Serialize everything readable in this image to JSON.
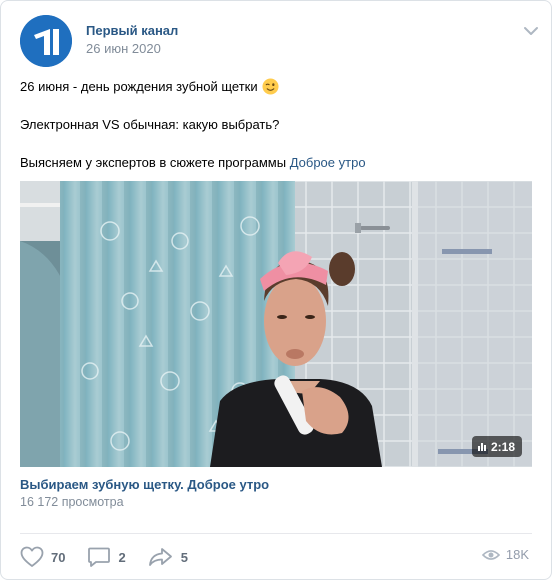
{
  "post": {
    "author": "Первый канал",
    "date": "26 июн 2020",
    "text_line1": "26 июня - день рождения зубной щетки",
    "text_line2": "Электронная VS обычная: какую выбрать?",
    "text_line3_prefix": "Выясняем у экспертов в сюжете программы ",
    "text_line3_link": "Доброе утро"
  },
  "video": {
    "duration": "2:18",
    "title": "Выбираем зубную щетку. Доброе утро",
    "views": "16 172 просмотра"
  },
  "actions": {
    "likes": "70",
    "comments": "2",
    "shares": "5",
    "views": "18K"
  },
  "icons": {
    "avatar": "channel-one-logo",
    "menu": "chevron-down-icon",
    "emoji": "winking-face-emoji",
    "like": "heart-icon",
    "comment": "comment-icon",
    "share": "share-icon",
    "views": "eye-icon"
  },
  "colors": {
    "link": "#2a5885",
    "secondary": "#818c99",
    "avatar_bg": "#1f6fbf"
  }
}
